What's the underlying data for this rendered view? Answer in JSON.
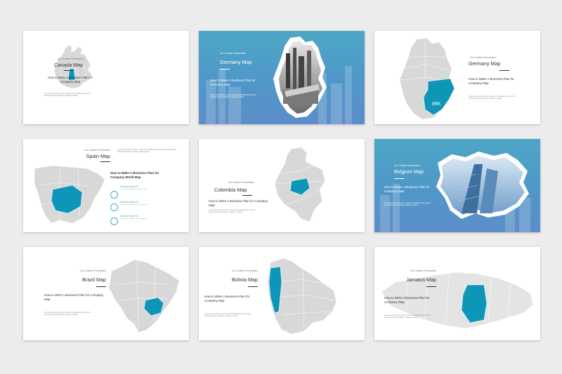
{
  "colors": {
    "accent": "#0e96b8",
    "map_gray": "#d8d8d8",
    "blue_bg": "#4f9fc8"
  },
  "slides": [
    {
      "name": "canada",
      "subtitle": "Our Creative Presentation",
      "title": "Canada Map",
      "heading": "How to Write A Business Plan for Company Map",
      "body": "Lorem ipsum dolor sit amet, consectetur adipiscing elit, sed do eiusmod tempor incididunt ut labore et dolore."
    },
    {
      "name": "germany-photo",
      "subtitle": "Our Creative Presentation",
      "title": "Germany Map",
      "heading": "How to Make A Business Plan for Company Map",
      "body": "Lorem ipsum dolor sit amet, consectetur adipiscing elit, sed do eiusmod tempor incididunt ut labore et dolore."
    },
    {
      "name": "germany",
      "subtitle": "Our Creative Presentation",
      "title": "Germany Map",
      "heading": "How to Make A Business Plan for Company Map",
      "body": "Lorem ipsum dolor sit amet, consectetur adipiscing elit, sed do eiusmod tempor incididunt ut labore et dolore.",
      "badge": "89K"
    },
    {
      "name": "spain",
      "subtitle": "Our Creative Presentation",
      "title": "Spain Map",
      "intro": "Lorem ipsum dolor sit amet, consectetur adipiscing elit, sed do eiusmod tempor incididunt ut labore et dolore magna aliqua.",
      "heading": "How to Make A Business Plan for Company World Map",
      "items": [
        {
          "title": "Example Detail #1",
          "text": "Lorem ipsum dolor sit amet consectetur"
        },
        {
          "title": "Example Detail #2",
          "text": "Lorem ipsum dolor sit amet consectetur"
        },
        {
          "title": "Example Detail #3",
          "text": "Lorem ipsum dolor sit amet consectetur"
        }
      ]
    },
    {
      "name": "colombia",
      "subtitle": "Our Creative Presentation",
      "title": "Colombia Map",
      "heading": "How to Write A Business Plan for Company Map",
      "body": "Lorem ipsum dolor sit amet, consectetur adipiscing elit, sed do eiusmod tempor incididunt ut labore et dolore."
    },
    {
      "name": "belgium-photo",
      "subtitle": "Our Creative Presentation",
      "title": "Belgium Map",
      "heading": "How to Make A Business Plan for Company Map",
      "body": "Lorem ipsum dolor sit amet, consectetur adipiscing elit, sed do eiusmod tempor incididunt ut labore et dolore."
    },
    {
      "name": "brazil",
      "subtitle": "Our Creative Presentation",
      "title": "Brazil Map",
      "heading": "How to Write A Business Plan for Company Map",
      "body": "Lorem ipsum dolor sit amet, consectetur adipiscing elit, sed do eiusmod tempor incididunt ut labore et dolore."
    },
    {
      "name": "bolivia",
      "subtitle": "Our Creative Presentation",
      "title": "Bolivia Map",
      "heading": "How to Write A Business Plan for Company Map",
      "body": "Lorem ipsum dolor sit amet, consectetur adipiscing elit, sed do eiusmod tempor incididunt ut labore et dolore."
    },
    {
      "name": "jamaica",
      "subtitle": "Our Creative Presentation",
      "title": "Jamaica Map",
      "heading": "How to Write A Business Plan for Company Map",
      "body": "Lorem ipsum dolor sit amet, consectetur adipiscing elit, sed do eiusmod tempor incididunt ut labore et dolore."
    }
  ]
}
